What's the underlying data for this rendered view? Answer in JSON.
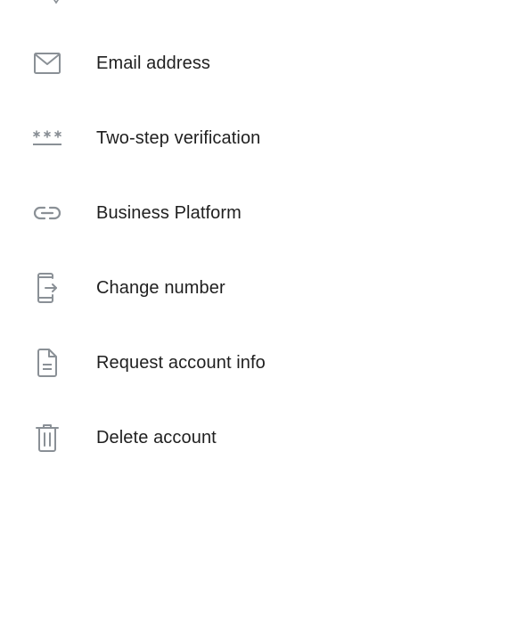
{
  "colors": {
    "background": "#ffffff",
    "text": "#1f1f1f",
    "icon": "#8a9096"
  },
  "settings": {
    "items": [
      {
        "label": "Email address",
        "icon": "envelope-icon"
      },
      {
        "label": "Two-step verification",
        "icon": "asterisk-password-icon"
      },
      {
        "label": "Business Platform",
        "icon": "link-icon"
      },
      {
        "label": "Change number",
        "icon": "phone-transfer-icon"
      },
      {
        "label": "Request account info",
        "icon": "document-icon"
      },
      {
        "label": "Delete account",
        "icon": "trash-icon"
      }
    ]
  }
}
